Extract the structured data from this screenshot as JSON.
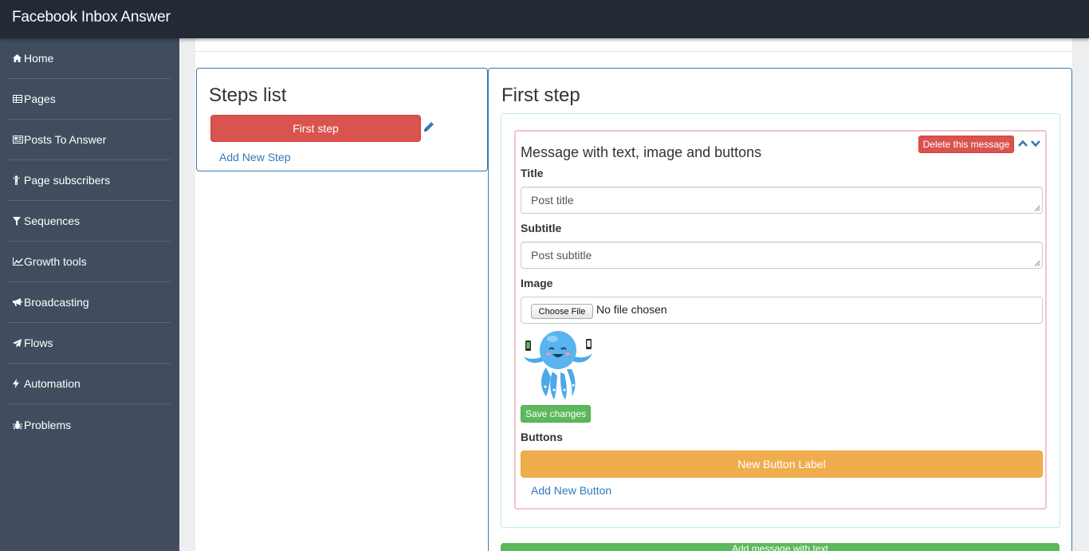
{
  "app": {
    "title": "Facebook Inbox Answer"
  },
  "sidebar": {
    "items": [
      {
        "label": "Home",
        "icon": "home-icon"
      },
      {
        "label": "Pages",
        "icon": "table-icon"
      },
      {
        "label": "Posts To Answer",
        "icon": "newspaper-icon"
      },
      {
        "label": "Page subscribers",
        "icon": "child-icon"
      },
      {
        "label": "Sequences",
        "icon": "filter-icon"
      },
      {
        "label": "Growth tools",
        "icon": "line-chart-icon"
      },
      {
        "label": "Broadcasting",
        "icon": "bullhorn-icon"
      },
      {
        "label": "Flows",
        "icon": "paper-plane-icon"
      },
      {
        "label": "Automation",
        "icon": "bolt-icon"
      },
      {
        "label": "Problems",
        "icon": "bug-icon"
      }
    ]
  },
  "steps_panel": {
    "title": "Steps list",
    "steps": [
      "First step"
    ],
    "add_step_label": "Add New Step"
  },
  "step_panel": {
    "title": "First step",
    "message": {
      "title": "Message with text, image and buttons",
      "delete_label": "Delete this message",
      "title_label": "Title",
      "title_value": "Post title",
      "subtitle_label": "Subtitle",
      "subtitle_value": "Post subtitle",
      "image_label": "Image",
      "choose_file_label": "Choose File",
      "no_file_text": "No file chosen",
      "save_label": "Save changes",
      "buttons_label": "Buttons",
      "button_labels": [
        "New Button Label"
      ],
      "add_button_label": "Add New Button"
    },
    "add_message_label": "Add message with text"
  },
  "colors": {
    "topbar": "#232a36",
    "sidebar": "#414d5f",
    "primary": "#337ab7",
    "danger": "#d9534f",
    "warning": "#f0ad4e",
    "success": "#5cb85c"
  }
}
